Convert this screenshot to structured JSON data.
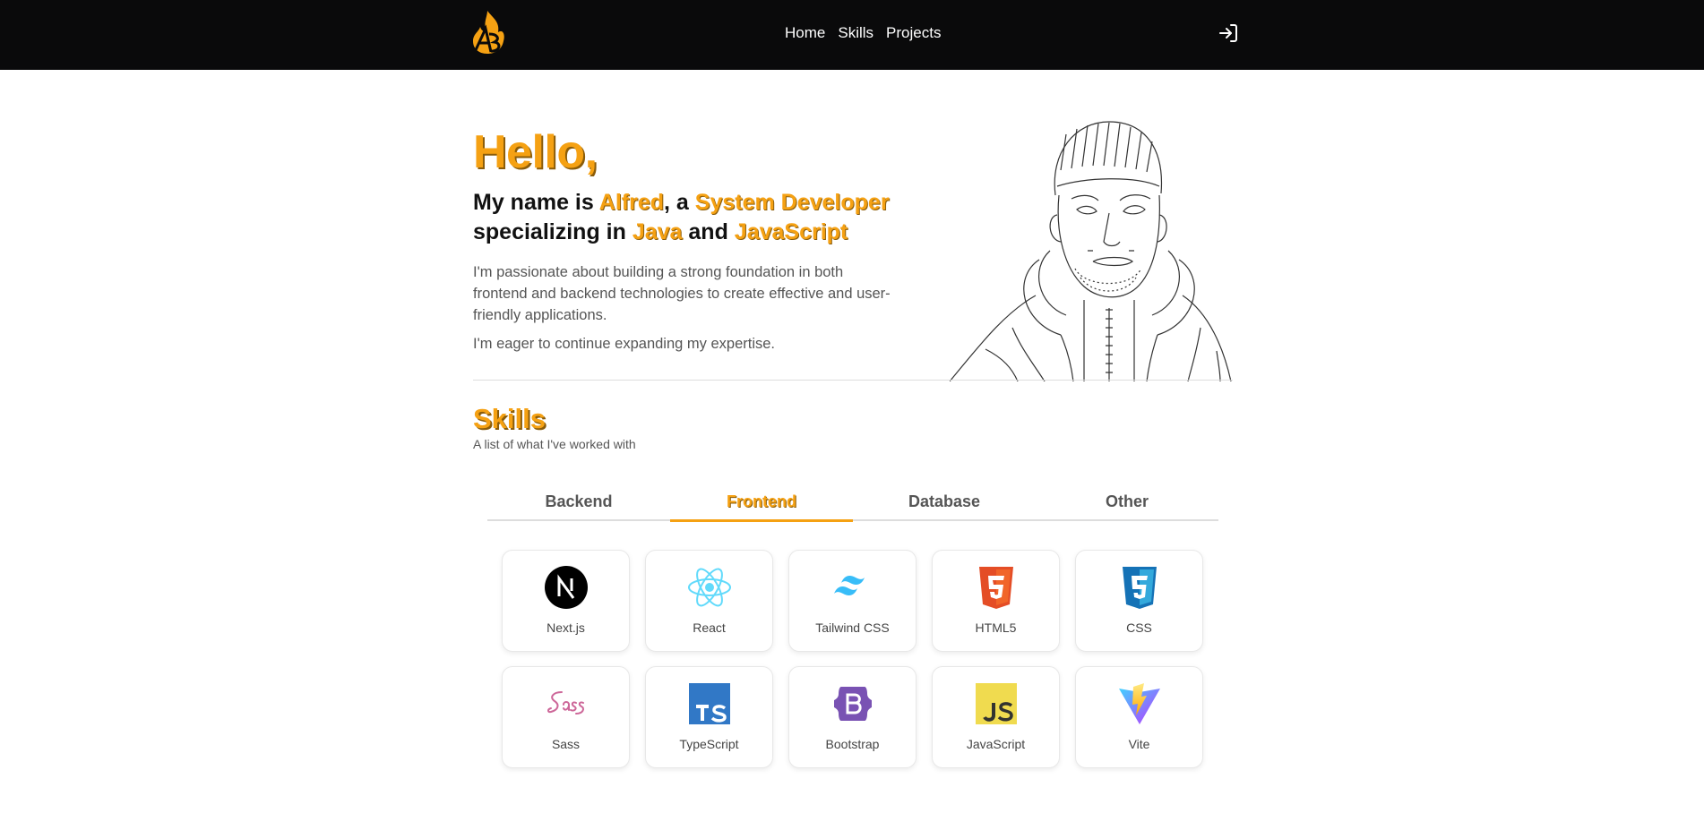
{
  "nav": {
    "links": [
      "Home",
      "Skills",
      "Projects"
    ]
  },
  "hero": {
    "greeting": "Hello,",
    "line1_prefix": "My name is ",
    "name": "Alfred",
    "line1_mid": ", a ",
    "role": "System Developer",
    "line2_prefix": "specializing in ",
    "lang1": "Java",
    "line2_mid": " and ",
    "lang2": "JavaScript",
    "description": "I'm passionate about building a strong foundation in both frontend and backend technologies to create effective and user-friendly applications.",
    "description2": "I'm eager to continue expanding my expertise."
  },
  "skills": {
    "title": "Skills",
    "subtitle": "A list of what I've worked with",
    "tabs": [
      {
        "label": "Backend",
        "active": false
      },
      {
        "label": "Frontend",
        "active": true
      },
      {
        "label": "Database",
        "active": false
      },
      {
        "label": "Other",
        "active": false
      }
    ],
    "items": [
      {
        "label": "Next.js",
        "icon": "nextjs-icon"
      },
      {
        "label": "React",
        "icon": "react-icon"
      },
      {
        "label": "Tailwind CSS",
        "icon": "tailwind-icon"
      },
      {
        "label": "HTML5",
        "icon": "html5-icon"
      },
      {
        "label": "CSS",
        "icon": "css-icon"
      },
      {
        "label": "Sass",
        "icon": "sass-icon"
      },
      {
        "label": "TypeScript",
        "icon": "typescript-icon"
      },
      {
        "label": "Bootstrap",
        "icon": "bootstrap-icon"
      },
      {
        "label": "JavaScript",
        "icon": "javascript-icon"
      },
      {
        "label": "Vite",
        "icon": "vite-icon"
      }
    ]
  },
  "colors": {
    "accent": "#f5a113",
    "navbar": "#0a0a0b"
  }
}
